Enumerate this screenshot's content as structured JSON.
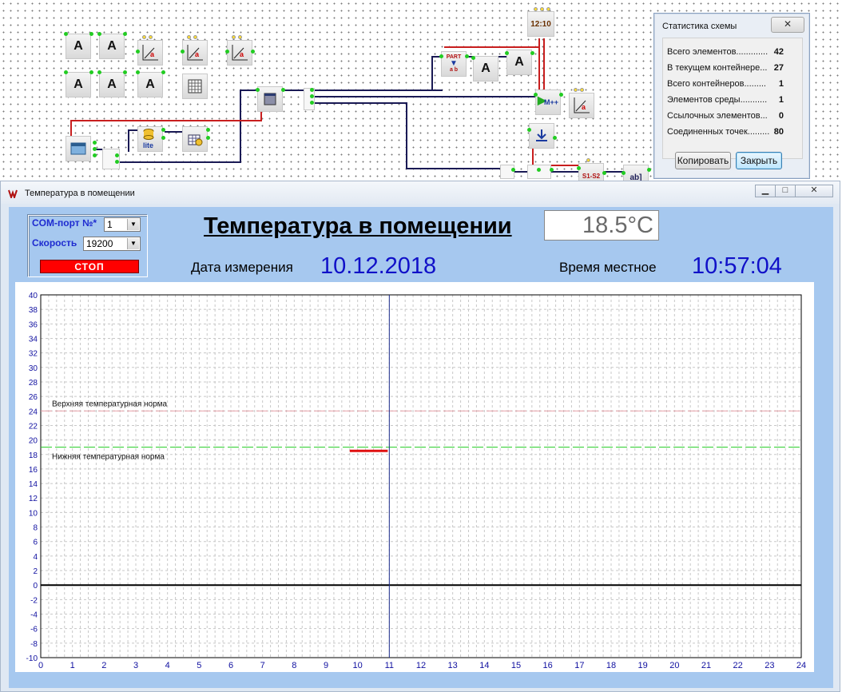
{
  "stats": {
    "title": "Статистика схемы",
    "close_glyph": "✕",
    "rows": [
      {
        "label": "Всего элементов.............",
        "value": "42"
      },
      {
        "label": "В текущем контейнере...",
        "value": "27"
      },
      {
        "label": "Всего контейнеров.........",
        "value": "1"
      },
      {
        "label": "Элементов среды...........",
        "value": "1"
      },
      {
        "label": "Ссылочных элементов...",
        "value": "0"
      },
      {
        "label": "Соединенных точек.........",
        "value": "80"
      }
    ],
    "copy_label": "Копировать",
    "close_label": "Закрыть"
  },
  "schema": {
    "clock_label": "12:10",
    "part_label": "PART",
    "part_sub": "a  b",
    "lite_label": "lite",
    "mpp_label": "M++",
    "s1s2_label": "S1-S2",
    "abl_label": "ab]",
    "a_label": "A"
  },
  "window": {
    "title": "Температура в помещении",
    "min_glyph": "▁",
    "max_glyph": "□",
    "close_glyph": "✕"
  },
  "controls": {
    "com_label": "COM-порт №*",
    "com_value": "1",
    "speed_label": "Скорость",
    "speed_value": "19200",
    "stop_label": "СТОП"
  },
  "header": {
    "title": "Температура в помещении",
    "temperature": "18.5°C",
    "date_label": "Дата измерения",
    "date_value": "10.12.2018",
    "time_label": "Время местное",
    "time_value": "10:57:04"
  },
  "colors": {
    "panel": "#a6c8ef",
    "value_blue": "#1010c8",
    "stop_red": "#ff0000",
    "upper_norm": "#e8a0a8",
    "lower_norm": "#22cc22",
    "series": "#e01010",
    "cursor": "#1c2c8c"
  },
  "chart_data": {
    "type": "line",
    "xlim": [
      0,
      24
    ],
    "ylim": [
      -10,
      40
    ],
    "x_ticks": [
      0,
      1,
      2,
      3,
      4,
      5,
      6,
      7,
      8,
      9,
      10,
      11,
      12,
      13,
      14,
      15,
      16,
      17,
      18,
      19,
      20,
      21,
      22,
      23,
      24
    ],
    "y_ticks": [
      -10,
      -8,
      -6,
      -4,
      -2,
      0,
      2,
      4,
      6,
      8,
      10,
      12,
      14,
      16,
      18,
      20,
      22,
      24,
      26,
      28,
      30,
      32,
      34,
      36,
      38,
      40
    ],
    "grid": true,
    "upper_norm": {
      "label": "Верхняя температурная норма",
      "value": 24
    },
    "lower_norm": {
      "label": "Нижняя температурная норма",
      "value": 19
    },
    "cursor_x": 11,
    "series": [
      {
        "x": [
          9.75,
          10.95
        ],
        "y": [
          18.5,
          18.5
        ]
      }
    ]
  }
}
